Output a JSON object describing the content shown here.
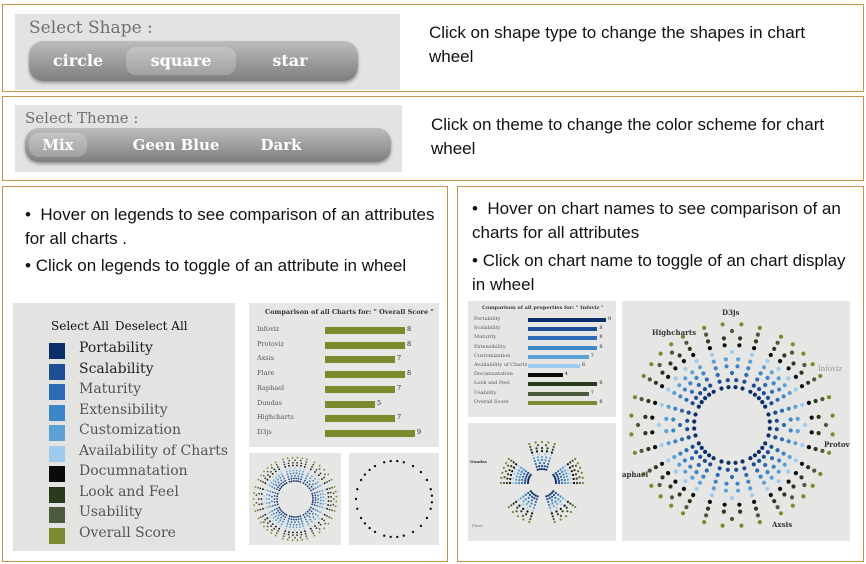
{
  "shape": {
    "label": "Select Shape :",
    "options": [
      "circle",
      "square",
      "star"
    ],
    "selected": "square",
    "note": "Click on shape type to change the shapes in chart wheel"
  },
  "theme": {
    "label": "Select Theme :",
    "options": [
      "Mix",
      "Geen Blue",
      "Dark"
    ],
    "selected": "Mix",
    "note": "Click on theme to change the color scheme for chart wheel"
  },
  "legend_panel": {
    "bullets": [
      "Hover on legends to see comparison of an attributes for all charts .",
      "Click on legends to toggle of an attribute in wheel"
    ],
    "select_all": "Select All",
    "deselect_all": "Deselect All",
    "items": [
      {
        "label": "Portability",
        "color": "#0b2f6b",
        "text_color": "#222222"
      },
      {
        "label": "Scalability",
        "color": "#1d4e95",
        "text_color": "#222222"
      },
      {
        "label": "Maturity",
        "color": "#2d6bb5",
        "text_color": "#555555"
      },
      {
        "label": "Extensibility",
        "color": "#3d86c9",
        "text_color": "#555555"
      },
      {
        "label": "Customization",
        "color": "#5ba1d8",
        "text_color": "#555555"
      },
      {
        "label": "Availability of Charts",
        "color": "#9ecbee",
        "text_color": "#555555"
      },
      {
        "label": "Documnatation",
        "color": "#0a0a0a",
        "text_color": "#555555"
      },
      {
        "label": "Look and Feel",
        "color": "#2a3a1c",
        "text_color": "#555555"
      },
      {
        "label": "Usability",
        "color": "#4b5a3a",
        "text_color": "#555555"
      },
      {
        "label": "Overall Score",
        "color": "#7a8a2c",
        "text_color": "#555555"
      }
    ],
    "comparison": {
      "title": "Comparison of all Charts for: \" Overall Score \"",
      "color": "#7a8a2c",
      "rows": [
        {
          "label": "Infoviz",
          "value": 8
        },
        {
          "label": "Protoviz",
          "value": 8
        },
        {
          "label": "Axsis",
          "value": 7
        },
        {
          "label": "Flare",
          "value": 8
        },
        {
          "label": "Raphael",
          "value": 7
        },
        {
          "label": "Dundas",
          "value": 5
        },
        {
          "label": "Highcharts",
          "value": 7
        },
        {
          "label": "D3js",
          "value": 9
        }
      ]
    }
  },
  "chart_panel": {
    "bullets": [
      "Hover on chart names to see comparison of an charts for all attributes",
      "Click on chart name to toggle of an chart display in wheel"
    ],
    "comparison": {
      "title": "Comparison of all properties for: \" Infoviz \"",
      "rows": [
        {
          "label": "Portability",
          "value": 9,
          "color": "#0b2f6b"
        },
        {
          "label": "Scalability",
          "value": 8,
          "color": "#1d4e95"
        },
        {
          "label": "Maturity",
          "value": 8,
          "color": "#2d6bb5"
        },
        {
          "label": "Extensibility",
          "value": 8,
          "color": "#3d86c9"
        },
        {
          "label": "Customization",
          "value": 7,
          "color": "#5ba1d8"
        },
        {
          "label": "Availability of Charts",
          "value": 6,
          "color": "#9ecbee"
        },
        {
          "label": "Documnatation",
          "value": 4,
          "color": "#0a0a0a"
        },
        {
          "label": "Look and Feel",
          "value": 8,
          "color": "#2a3a1c"
        },
        {
          "label": "Usability",
          "value": 7,
          "color": "#4b5a3a"
        },
        {
          "label": "Overall Score",
          "value": 8,
          "color": "#7a8a2c"
        }
      ]
    },
    "wheel_labels": {
      "d3js": "D3js",
      "highcharts": "Highcharts",
      "infoviz": "Infoviz",
      "protoviz": "Protoviz",
      "raphael": "aphael",
      "axsis": "Axsis"
    },
    "mini_labels": {
      "a": "Dundas",
      "b": "Flare"
    }
  }
}
